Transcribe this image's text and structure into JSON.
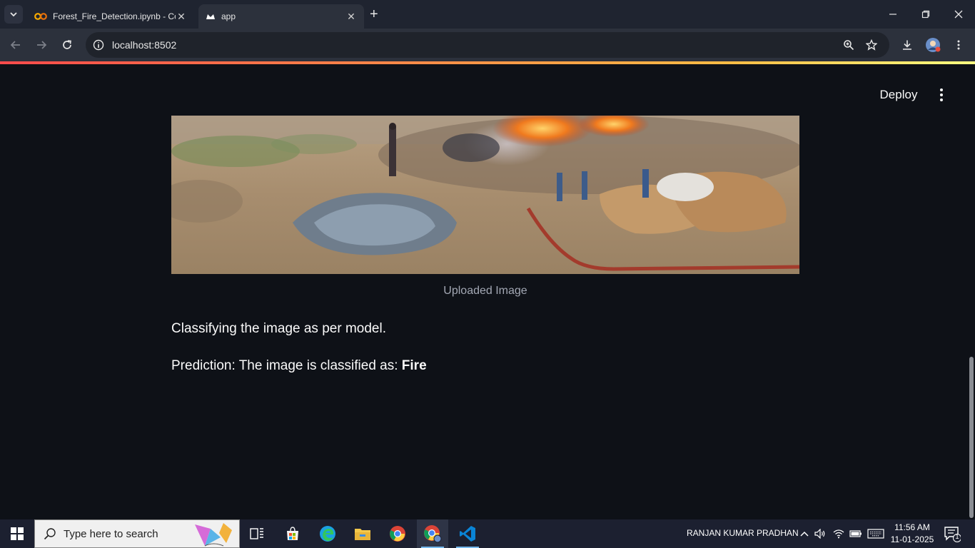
{
  "browser": {
    "tabs": [
      {
        "title": "Forest_Fire_Detection.ipynb - Co",
        "active": false,
        "icon": "colab-icon"
      },
      {
        "title": "app",
        "active": true,
        "icon": "streamlit-icon"
      }
    ],
    "url": "localhost:8502"
  },
  "app": {
    "deploy_label": "Deploy",
    "image_caption": "Uploaded Image",
    "status_text": "Classifying the image as per model.",
    "prediction_prefix": "Prediction: The image is classified as: ",
    "prediction_value": "Fire"
  },
  "taskbar": {
    "search_placeholder": "Type here to search",
    "user_name": "RANJAN KUMAR PRADHAN",
    "time": "11:56 AM",
    "date": "11-01-2025",
    "notification_count": "1"
  },
  "colors": {
    "app_background": "#0e1117",
    "accent_red": "#ff4b4b",
    "accent_yellow": "#ffbd45"
  }
}
